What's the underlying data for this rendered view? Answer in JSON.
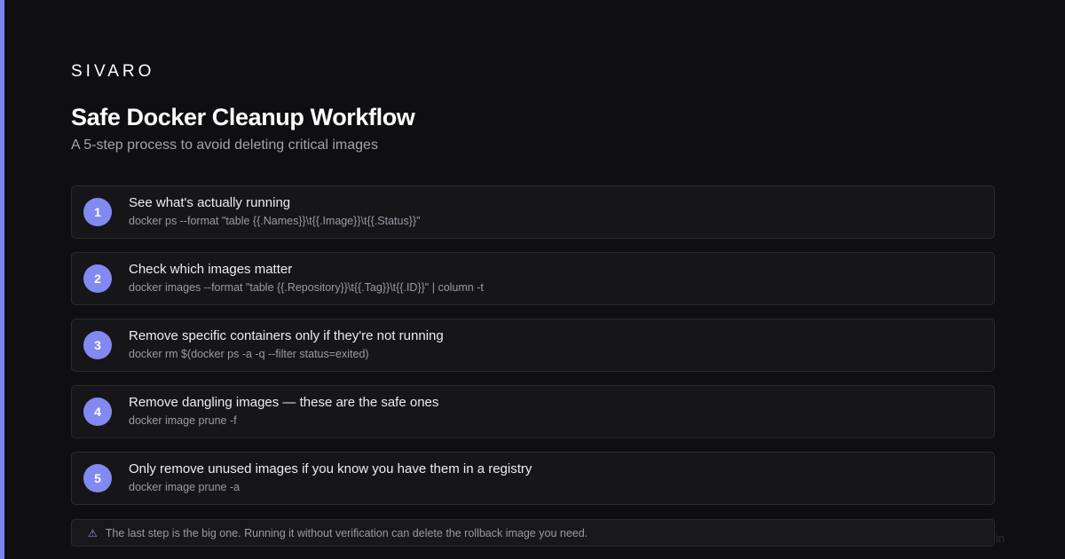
{
  "brand": "SIVARO",
  "title": "Safe Docker Cleanup Workflow",
  "subtitle": "A 5-step process to avoid deleting critical images",
  "steps": [
    {
      "number": "1",
      "title": "See what's actually running",
      "command": "docker ps --format \"table {{.Names}}\\t{{.Image}}\\t{{.Status}}\""
    },
    {
      "number": "2",
      "title": "Check which images matter",
      "command": "docker images --format \"table {{.Repository}}\\t{{.Tag}}\\t{{.ID}}\" | column -t"
    },
    {
      "number": "3",
      "title": "Remove specific containers only if they're not running",
      "command": "docker rm $(docker ps -a -q --filter status=exited)"
    },
    {
      "number": "4",
      "title": "Remove dangling images — these are the safe ones",
      "command": "docker image prune -f"
    },
    {
      "number": "5",
      "title": "Only remove unused images if you know you have them in a registry",
      "command": "docker image prune -a"
    }
  ],
  "warning": {
    "icon": "warning-icon",
    "text": "The last step is the big one. Running it without verification can delete the rollback image you need."
  },
  "corner_mark": "in",
  "colors": {
    "accent": "#7c83f5",
    "badge": "#8289f0",
    "background": "#0f0f11",
    "card": "#161619"
  }
}
